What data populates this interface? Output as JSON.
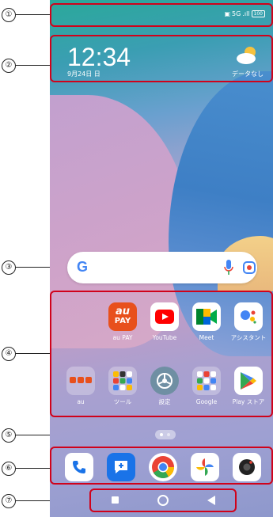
{
  "callouts": [
    "①",
    "②",
    "③",
    "④",
    "⑤",
    "⑥",
    "⑦"
  ],
  "status": {
    "network": "5G",
    "battery": "100"
  },
  "clock": {
    "time": "12:34",
    "date": "9月24日 日"
  },
  "weather": {
    "label": "データなし"
  },
  "search": {
    "logo": "G"
  },
  "apps_row1": [
    {
      "label": "au PAY",
      "icon": "au-pay-icon",
      "icon_text": "au PAY",
      "color": "#e8501c"
    },
    {
      "label": "YouTube",
      "icon": "youtube-icon",
      "color": "#ff0000"
    },
    {
      "label": "Meet",
      "icon": "meet-icon",
      "color": "#00897b"
    },
    {
      "label": "アシスタント",
      "icon": "assistant-icon",
      "color": "#4285f4"
    }
  ],
  "apps_row2": [
    {
      "label": "au",
      "icon": "au-folder-icon"
    },
    {
      "label": "ツール",
      "icon": "tools-folder-icon"
    },
    {
      "label": "設定",
      "icon": "settings-icon"
    },
    {
      "label": "Google",
      "icon": "google-folder-icon"
    },
    {
      "label": "Play ストア",
      "icon": "play-store-icon"
    }
  ],
  "dock": [
    {
      "name": "phone-icon",
      "color": "#1a73e8"
    },
    {
      "name": "messages-icon",
      "color": "#1a73e8"
    },
    {
      "name": "chrome-icon",
      "color": "#ffffff"
    },
    {
      "name": "photos-icon",
      "color": "#ffffff"
    },
    {
      "name": "camera-icon",
      "color": "#ffffff"
    }
  ],
  "navbar": {
    "buttons": [
      "recent-apps-button",
      "home-button",
      "back-button"
    ]
  }
}
